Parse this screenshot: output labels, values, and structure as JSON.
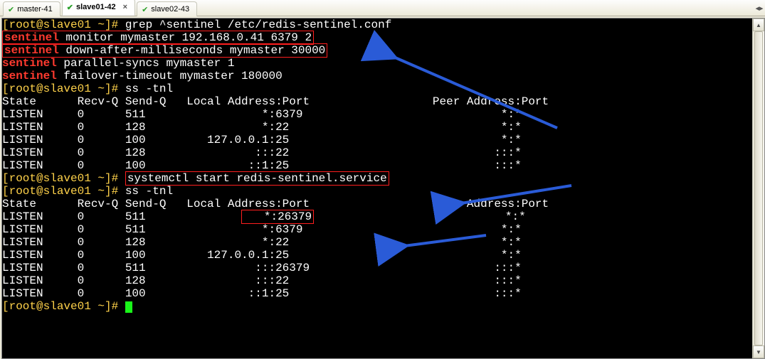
{
  "tabs": [
    {
      "label": "master-41",
      "active": false
    },
    {
      "label": "slave01-42",
      "active": true
    },
    {
      "label": "slave02-43",
      "active": false
    }
  ],
  "prompt": "[root@slave01 ~]# ",
  "cmd1": "grep ^sentinel /etc/redis-sentinel.conf",
  "sentinel_word": "sentinel",
  "conf_lines": [
    " monitor mymaster 192.168.0.41 6379 2",
    " down-after-milliseconds mymaster 30000",
    " parallel-syncs mymaster 1",
    " failover-timeout mymaster 180000"
  ],
  "cmd2": "ss -tnl",
  "ss_header": "State      Recv-Q Send-Q   Local Address:Port                  Peer Address:Port ",
  "ss_rows_1": [
    "LISTEN     0      511                 *:6379                             *:*   ",
    "LISTEN     0      128                 *:22                               *:*   ",
    "LISTEN     0      100         127.0.0.1:25                               *:*   ",
    "LISTEN     0      128                :::22                              :::*   ",
    "LISTEN     0      100               ::1:25                              :::*   "
  ],
  "cmd3": "systemctl start redis-sentinel.service",
  "ss_rows_2": [
    {
      "pre": "LISTEN     0      511              ",
      "mid": "   *:26379",
      "post": "                            *:*   ",
      "boxed": true
    },
    {
      "pre": "LISTEN     0      511                 *:6379                             *:*   ",
      "mid": "",
      "post": "",
      "boxed": false
    },
    {
      "pre": "LISTEN     0      128                 *:22                               *:*   ",
      "mid": "",
      "post": "",
      "boxed": false
    },
    {
      "pre": "LISTEN     0      100         127.0.0.1:25                               *:*   ",
      "mid": "",
      "post": "",
      "boxed": false
    },
    {
      "pre": "LISTEN     0      511                :::26379                           :::*   ",
      "mid": "",
      "post": "",
      "boxed": false
    },
    {
      "pre": "LISTEN     0      128                :::22                              :::*   ",
      "mid": "",
      "post": "",
      "boxed": false
    },
    {
      "pre": "LISTEN     0      100               ::1:25                              :::*   ",
      "mid": "",
      "post": "",
      "boxed": false
    }
  ]
}
